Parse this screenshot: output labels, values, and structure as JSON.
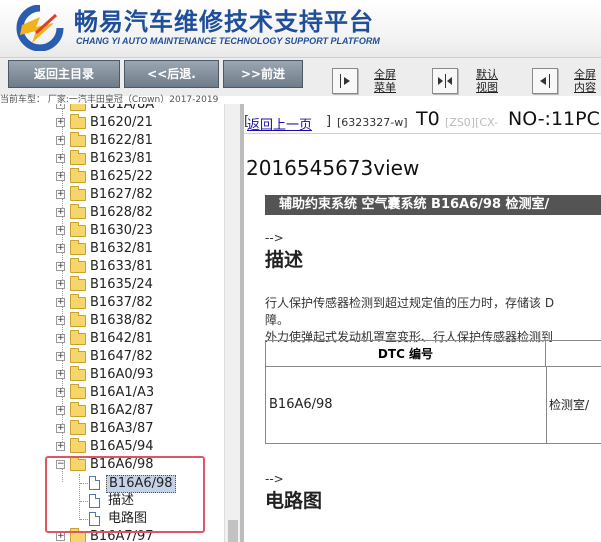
{
  "header": {
    "title_cn": "畅易汽车维修技术支持平台",
    "title_en": "CHANG YI AUTO MAINTENANCE TECHNOLOGY SUPPORT PLATFORM",
    "brand_color": "#1f4f9a"
  },
  "toolbar": {
    "home_label": "返回主目录",
    "back_label": "<<后退.",
    "forward_label": ">>前进",
    "fullscreen_menu_line1": "全屏",
    "fullscreen_menu_line2": "菜单",
    "default_view_line1": "默认",
    "default_view_line2": "视图",
    "fullscreen_content_line1": "全屏",
    "fullscreen_content_line2": "内容"
  },
  "vehicle_info": "当前车型：  厂家:一汽丰田皇冠（Crown）2017-2019",
  "tree": {
    "items": [
      {
        "label": "B161A/8A"
      },
      {
        "label": "B1620/21"
      },
      {
        "label": "B1622/81"
      },
      {
        "label": "B1623/81"
      },
      {
        "label": "B1625/22"
      },
      {
        "label": "B1627/82"
      },
      {
        "label": "B1628/82"
      },
      {
        "label": "B1630/23"
      },
      {
        "label": "B1632/81"
      },
      {
        "label": "B1633/81"
      },
      {
        "label": "B1635/24"
      },
      {
        "label": "B1637/82"
      },
      {
        "label": "B1638/82"
      },
      {
        "label": "B1642/81"
      },
      {
        "label": "B1647/82"
      },
      {
        "label": "B16A0/93"
      },
      {
        "label": "B16A1/A3"
      },
      {
        "label": "B16A2/87"
      },
      {
        "label": "B16A3/87"
      },
      {
        "label": "B16A5/94"
      },
      {
        "label": "B16A6/98"
      },
      {
        "label": "B16A7/97"
      }
    ],
    "expanded_children": [
      {
        "label": "B16A6/98"
      },
      {
        "label": "描述"
      },
      {
        "label": "电路图"
      }
    ]
  },
  "content": {
    "back_link": "返回上一页",
    "doc_code": "[6323327-w]",
    "t0": "T0",
    "zs0": "[ZS0][CX-",
    "no_code": "NO-:11PC",
    "view_id": "2016545673view",
    "breadcrumb": "辅助约束系统 空气囊系统 B16A6/98 检测室/",
    "arrow1": "-->",
    "section_desc": "描述",
    "para1": "行人保护传感器检测到超过规定值的压力时，存储该 D",
    "para2": "障。",
    "para3": "外力使弹起式发动机罩室变形、行人保护传感器检测到",
    "table_header": "DTC 编号",
    "table_dtc": "B16A6/98",
    "table_col2": "检测室/",
    "arrow2": "-->",
    "section_circuit": "电路图"
  }
}
